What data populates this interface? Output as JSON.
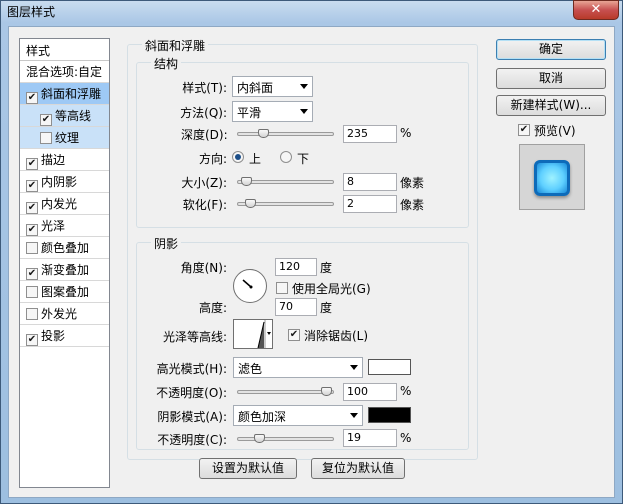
{
  "window": {
    "title": "图层样式",
    "close_label": "✕"
  },
  "styles": {
    "header": "样式",
    "items": [
      {
        "label": "混合选项:自定",
        "checked": null,
        "selected": false,
        "sub": false
      },
      {
        "label": "斜面和浮雕",
        "checked": true,
        "selected": true,
        "sub": false
      },
      {
        "label": "等高线",
        "checked": true,
        "selected": false,
        "sub": true
      },
      {
        "label": "纹理",
        "checked": false,
        "selected": false,
        "sub": true
      },
      {
        "label": "描边",
        "checked": true,
        "selected": false,
        "sub": false
      },
      {
        "label": "内阴影",
        "checked": true,
        "selected": false,
        "sub": false
      },
      {
        "label": "内发光",
        "checked": true,
        "selected": false,
        "sub": false
      },
      {
        "label": "光泽",
        "checked": true,
        "selected": false,
        "sub": false
      },
      {
        "label": "颜色叠加",
        "checked": false,
        "selected": false,
        "sub": false
      },
      {
        "label": "渐变叠加",
        "checked": true,
        "selected": false,
        "sub": false
      },
      {
        "label": "图案叠加",
        "checked": false,
        "selected": false,
        "sub": false
      },
      {
        "label": "外发光",
        "checked": false,
        "selected": false,
        "sub": false
      },
      {
        "label": "投影",
        "checked": true,
        "selected": false,
        "sub": false
      }
    ]
  },
  "bevel": {
    "group_title": "斜面和浮雕",
    "structure_title": "结构",
    "style_label": "样式(T):",
    "style_value": "内斜面",
    "technique_label": "方法(Q):",
    "technique_value": "平滑",
    "depth_label": "深度(D):",
    "depth_value": "235",
    "depth_unit": "%",
    "depth_pct": 0.235,
    "direction_label": "方向:",
    "direction_up": "上",
    "direction_down": "下",
    "size_label": "大小(Z):",
    "size_value": "8",
    "size_unit": "像素",
    "size_pct": 0.04,
    "soften_label": "软化(F):",
    "soften_value": "2",
    "soften_unit": "像素",
    "soften_pct": 0.08
  },
  "shading": {
    "title": "阴影",
    "angle_label": "角度(N):",
    "angle_value": "120",
    "angle_unit": "度",
    "global_light_label": "使用全局光(G)",
    "global_light_checked": false,
    "altitude_label": "高度:",
    "altitude_value": "70",
    "altitude_unit": "度",
    "gloss_label": "光泽等高线:",
    "antialias_label": "消除锯齿(L)",
    "antialias_checked": true,
    "highlight_mode_label": "高光模式(H):",
    "highlight_mode_value": "滤色",
    "highlight_color": "#ffffff",
    "highlight_opacity_label": "不透明度(O):",
    "highlight_opacity_value": "100",
    "highlight_opacity_unit": "%",
    "highlight_opacity_pct": 1.0,
    "shadow_mode_label": "阴影模式(A):",
    "shadow_mode_value": "颜色加深",
    "shadow_color": "#000000",
    "shadow_opacity_label": "不透明度(C):",
    "shadow_opacity_value": "19",
    "shadow_opacity_unit": "%",
    "shadow_opacity_pct": 0.19
  },
  "buttons": {
    "set_default": "设置为默认值",
    "reset_default": "复位为默认值",
    "ok": "确定",
    "cancel": "取消",
    "new_style": "新建样式(W)...",
    "preview_label": "预览(V)",
    "preview_checked": true
  }
}
